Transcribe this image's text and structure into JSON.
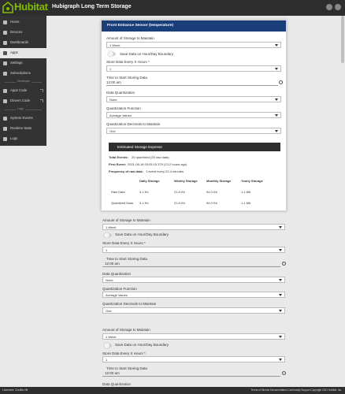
{
  "brand": {
    "name": "Hubitat",
    "color": "#81bc00"
  },
  "app_title": "Hubigraph Long Term Storage",
  "sidebar": {
    "items": [
      {
        "label": "Home",
        "icon": "home-icon"
      },
      {
        "label": "Devices",
        "icon": "devices-icon"
      },
      {
        "label": "Dashboards",
        "icon": "dashboard-icon"
      },
      {
        "label": "Apps",
        "icon": "apps-icon"
      },
      {
        "label": "Settings",
        "icon": "gear-icon"
      },
      {
        "label": "Subscriptions",
        "icon": "subscriptions-icon"
      }
    ],
    "sep_developer": "Developer",
    "dev_items": [
      {
        "label": "Apps Code",
        "icon": "code-icon"
      },
      {
        "label": "Drivers Code",
        "icon": "code-icon"
      }
    ],
    "sep_logs": "Logs",
    "log_items": [
      {
        "label": "System Events",
        "icon": "events-icon"
      },
      {
        "label": "Runtime Stats",
        "icon": "stats-icon"
      },
      {
        "label": "Logs",
        "icon": "logs-icon"
      }
    ]
  },
  "card": {
    "title": "Front Entrance Sensor (temperature)",
    "amount_label": "Amount of Storage to Maintain",
    "amount_value": "1 Week",
    "save_label": "Save Data on Hour/Day Boundary",
    "store_label": "Store Data Every X Hours *",
    "store_value": "1",
    "time_label": "Time to Start Storing Data",
    "time_value": "12:00 am",
    "quant_label": "Data Quantization",
    "quant_value": "None",
    "func_label": "Quantization Function",
    "func_value": "Average Values",
    "dec_label": "Quantization Decimals to Maintain",
    "dec_value": "One",
    "estimate_title": "Estimated Storage Expense",
    "total_label": "Total Events:",
    "total_value": "20 quantized (20 raw data)",
    "first_label": "First Event:",
    "first_value": "2021-06-18 03:05:15.379 (13.2 hours ago)",
    "freq_label": "Frequency of raw data:",
    "freq_value": "1 event every 22.4 minutes",
    "table": {
      "headers": [
        "Daily Storage",
        "Weekly Storage",
        "Monthly Storage",
        "Yearly Storage"
      ],
      "rows": [
        {
          "label": "Raw Data",
          "values": [
            "3.1 Kb",
            "21.8 Kb",
            "94.0 Kb",
            "1.1 Mb"
          ]
        },
        {
          "label": "Quantized Data",
          "values": [
            "3.1 Kb",
            "21.8 Kb",
            "94.0 Kb",
            "1.1 Mb"
          ]
        }
      ]
    }
  },
  "section2": {
    "amount_label": "Amount of Storage to Maintain",
    "amount_value": "1 Week",
    "save_label": "Save Data on Hour/Day Boundary",
    "store_label": "Store Data Every X Hours *",
    "store_value": "1",
    "time_label": "Time to Start Storing Data",
    "time_value": "12:00 am",
    "quant_label": "Data Quantization",
    "quant_value": "None",
    "func_label": "Quantization Function",
    "func_value": "Average Values",
    "dec_label": "Quantization Decimals to Maintain",
    "dec_value": "One"
  },
  "section3": {
    "amount_label": "Amount of Storage to Maintain",
    "amount_value": "1 Week",
    "save_label": "Save Data on Hour/Day Boundary",
    "store_label": "Store Data Every X Hours *",
    "store_value": "1",
    "time_label": "Time to Start Storing Data",
    "time_value": "12:00 am",
    "quant_label": "Data Quantization"
  },
  "footer": {
    "left": "Licensed: Credits Hit",
    "right": "Terms of Service   Documentation   Community   Support   Copyright 2021 Hubitat, Inc."
  }
}
